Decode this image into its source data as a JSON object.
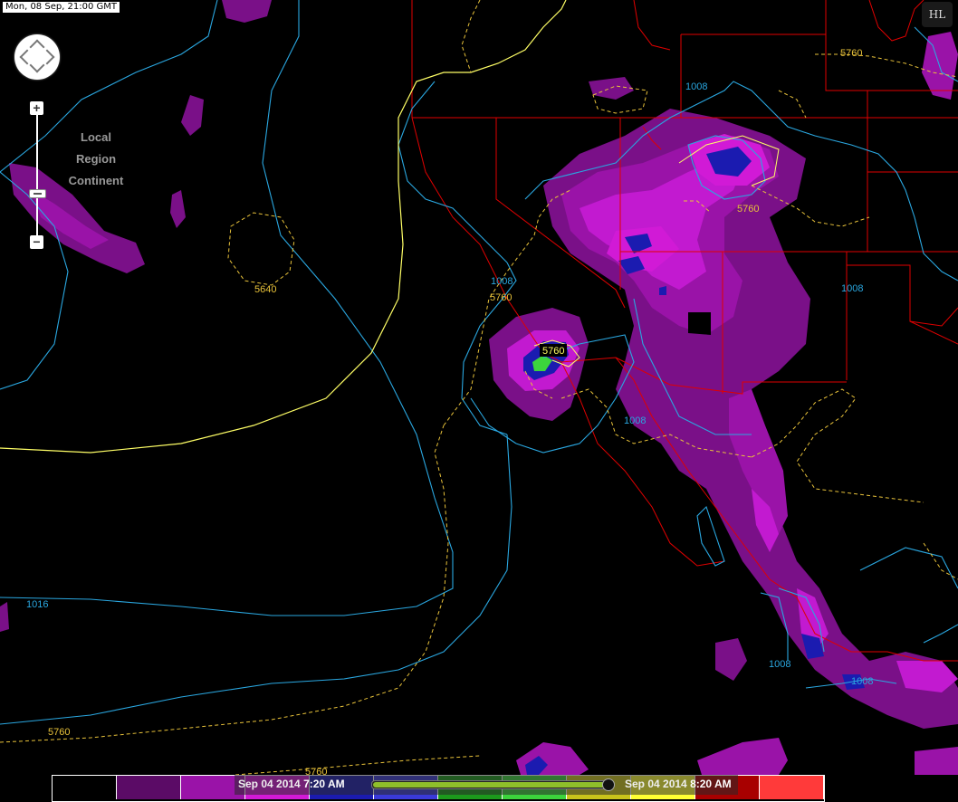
{
  "timestamp": "Mon, 08 Sep, 21:00 GMT",
  "logo_text": "HL",
  "zoom_levels": [
    "Local",
    "Region",
    "Continent"
  ],
  "zoom_in_label": "+",
  "zoom_out_label": "−",
  "contour_labels": {
    "c5760_top": "5760",
    "c1008_top": "1008",
    "c5760_ne": "5760",
    "c5640": "5640",
    "c1008_ca": "1008",
    "c5760_ca": "5760",
    "c5760_center": "5760",
    "c1008_east": "1008",
    "c1008_baja": "1008",
    "c1016": "1016",
    "c1008_mex": "1008",
    "c1008_mex2": "1008",
    "c5760_sw": "5760",
    "c5760_bottom": "5760"
  },
  "legend_colors": [
    "#000000",
    "#5b0b66",
    "#9a13a8",
    "#d11ad6",
    "#1b1bb0",
    "#3a3ad8",
    "#1c9a1c",
    "#3cd43c",
    "#c9c31b",
    "#ffff33",
    "#a80000",
    "#ff3a3a"
  ],
  "timebar": {
    "start_date": "Sep 04 2014",
    "start_time": "7:20 AM",
    "end_date": "Sep 04 2014",
    "end_time": "8:20 AM",
    "progress": 0.97
  },
  "colors": {
    "isobar": "#2aa7e0",
    "height_contour": "#e8c23a",
    "height_solid": "#ffff66",
    "borders": "#e00000"
  }
}
